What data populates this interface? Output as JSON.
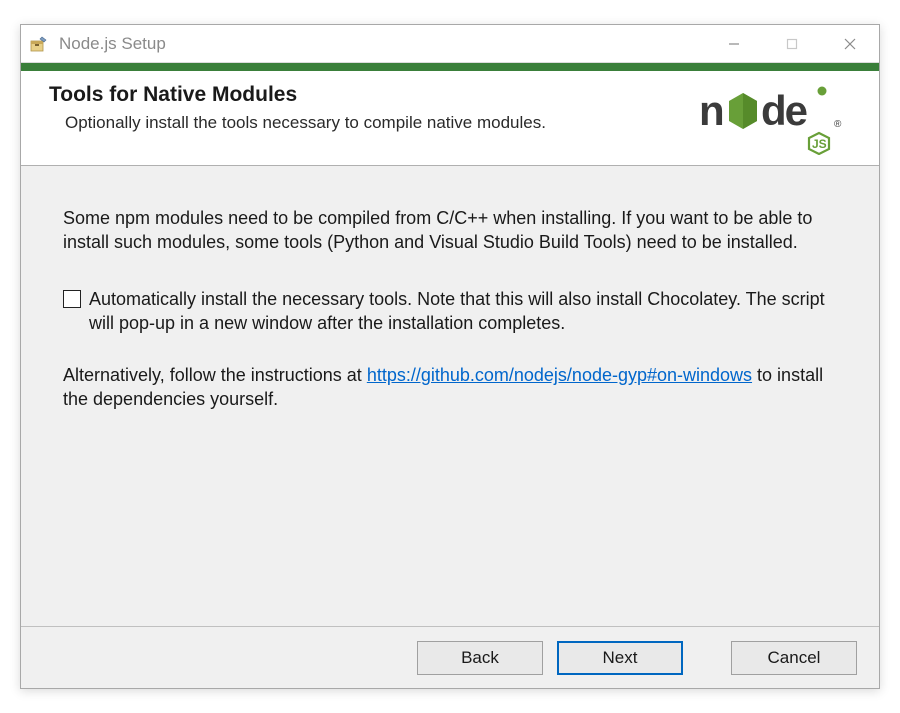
{
  "window": {
    "title": "Node.js Setup"
  },
  "header": {
    "title": "Tools for Native Modules",
    "subtitle": "Optionally install the tools necessary to compile native modules."
  },
  "content": {
    "intro": "Some npm modules need to be compiled from C/C++ when installing. If you want to be able to install such modules, some tools (Python and Visual Studio Build Tools) need to be installed.",
    "checkbox_label": "Automatically install the necessary tools. Note that this will also install Chocolatey. The script will pop-up in a new window after the installation completes.",
    "checkbox_checked": false,
    "alt_prefix": "Alternatively, follow the instructions at ",
    "alt_link": "https://github.com/nodejs/node-gyp#on-windows",
    "alt_suffix": " to install the dependencies yourself."
  },
  "buttons": {
    "back": "Back",
    "next": "Next",
    "cancel": "Cancel"
  },
  "colors": {
    "accent_green": "#3a7f3a",
    "link_blue": "#0066cc",
    "primary_border": "#0067c0"
  }
}
